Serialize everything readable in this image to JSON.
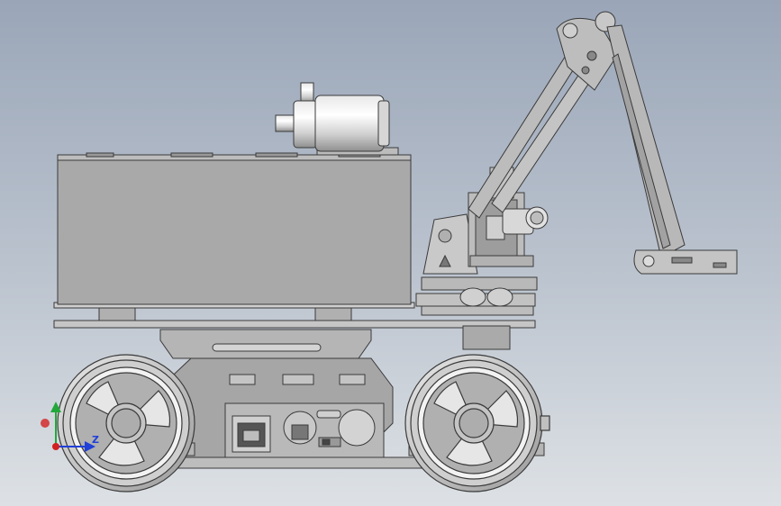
{
  "viewport": {
    "background_top": "#9aa6b8",
    "background_bottom": "#dde1e5"
  },
  "colors": {
    "body_fill": "#a9a9a9",
    "plate_fill": "#bdbdbd",
    "line": "#3a3a3a",
    "motor_highlight": "#f4f4f4",
    "triad_x": "#d32020",
    "triad_y": "#22a83a",
    "triad_z": "#2040d8"
  },
  "triad": {
    "z_label": "Z"
  },
  "model": {
    "parts": [
      "main-body-box",
      "chassis-plate",
      "motor",
      "robot-arm",
      "camera-module",
      "rotary-base",
      "left-wheel",
      "right-wheel",
      "lower-chassis"
    ]
  }
}
